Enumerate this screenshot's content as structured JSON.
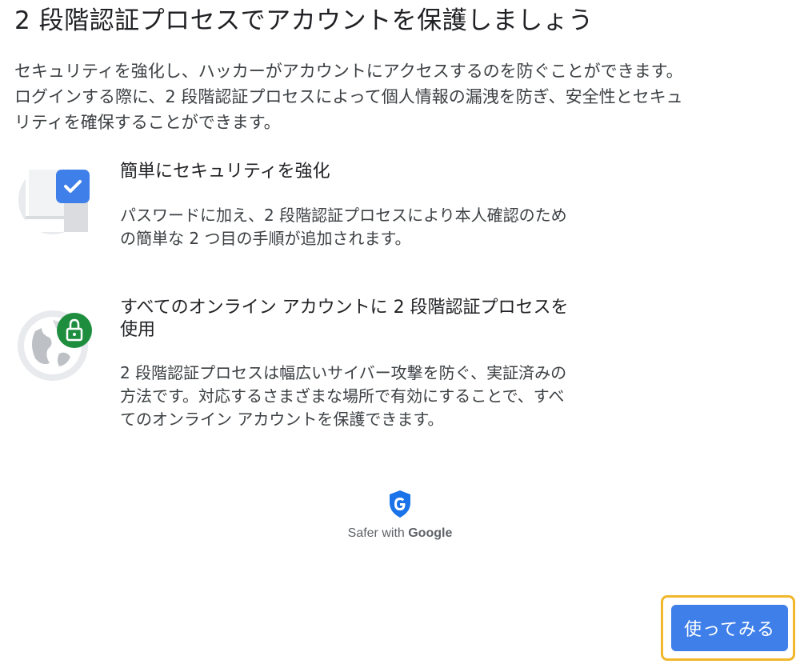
{
  "page": {
    "title": "2 段階認証プロセスでアカウントを保護しましょう",
    "intro_lines": [
      "セキュリティを強化し、ハッカーがアカウントにアクセスするのを防ぐことができます。",
      "ログインする際に、2 段階認証プロセスによって個人情報の漏洩を防ぎ、安全性とセキュ",
      "リティを確保することができます。"
    ]
  },
  "features": [
    {
      "icon": "phone-checkmark-icon",
      "heading_lines": [
        "簡単にセキュリティを強化"
      ],
      "desc_lines": [
        "パスワードに加え、2 段階認証プロセスにより本人確認のため",
        "の簡単な 2 つ目の手順が追加されます。"
      ]
    },
    {
      "icon": "globe-lock-icon",
      "heading_lines": [
        "すべてのオンライン アカウントに 2 段階認証プロセスを",
        "使用"
      ],
      "desc_lines": [
        "2 段階認証プロセスは幅広いサイバー攻撃を防ぐ、実証済みの",
        "方法です。対応するさまざまな場所で有効にすることで、すべ",
        "てのオンライン アカウントを保護できます。"
      ]
    }
  ],
  "brand": {
    "icon": "google-shield-icon",
    "text_prefix": "Safer with ",
    "text_brand": "Google"
  },
  "cta": {
    "label": "使ってみる"
  },
  "colors": {
    "primary_button": "#3f7fea",
    "focus_ring": "#f2b72b",
    "check_blue": "#3f7fea",
    "lock_green": "#1e8e3e"
  }
}
